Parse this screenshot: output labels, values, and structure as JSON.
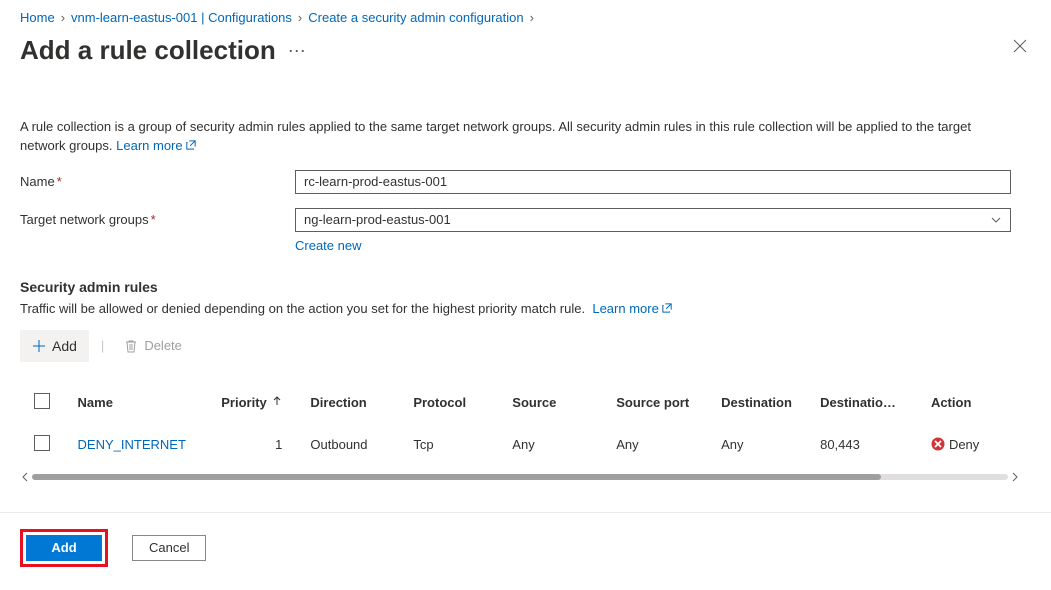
{
  "breadcrumb": {
    "home": "Home",
    "item1": "vnm-learn-eastus-001 | Configurations",
    "item2": "Create a security admin configuration"
  },
  "title": "Add a rule collection",
  "description": "A rule collection is a group of security admin rules applied to the same target network groups. All security admin rules in this rule collection will be applied to the target network groups.",
  "learn_more": "Learn more",
  "fields": {
    "name_label": "Name",
    "name_value": "rc-learn-prod-eastus-001",
    "target_label": "Target network groups",
    "target_value": "ng-learn-prod-eastus-001",
    "create_new": "Create new"
  },
  "rules_section": {
    "heading": "Security admin rules",
    "hint": "Traffic will be allowed or denied depending on the action you set for the highest priority match rule.",
    "learn_more": "Learn more"
  },
  "toolbar": {
    "add": "Add",
    "delete": "Delete"
  },
  "table": {
    "headers": {
      "name": "Name",
      "priority": "Priority",
      "direction": "Direction",
      "protocol": "Protocol",
      "source": "Source",
      "source_port": "Source port",
      "destination": "Destination",
      "destination_port": "Destinatio…",
      "action": "Action"
    },
    "rows": [
      {
        "name": "DENY_INTERNET",
        "priority": "1",
        "direction": "Outbound",
        "protocol": "Tcp",
        "source": "Any",
        "source_port": "Any",
        "destination": "Any",
        "destination_port": "80,443",
        "action": "Deny"
      }
    ]
  },
  "footer": {
    "add": "Add",
    "cancel": "Cancel"
  }
}
